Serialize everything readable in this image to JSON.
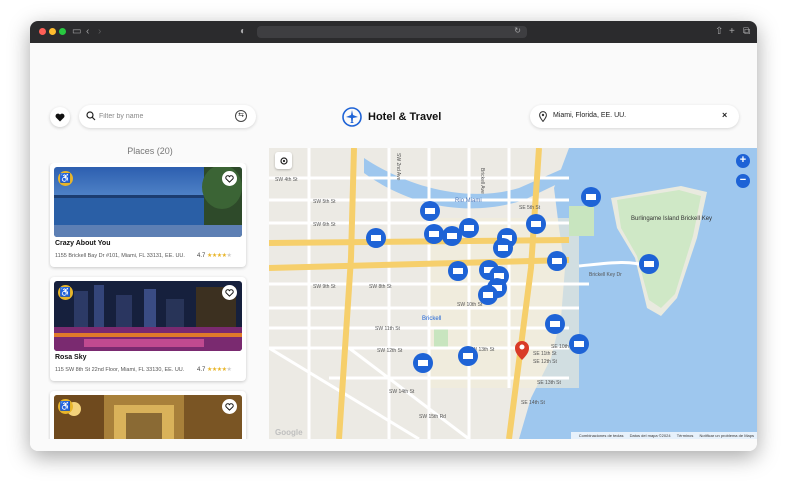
{
  "brand": {
    "title": "Hotel & Travel"
  },
  "filter": {
    "placeholder": "Filter by name"
  },
  "location": {
    "value": "Miami, Florida, EE. UU.",
    "clear": "×"
  },
  "places": {
    "title": "Places (20)"
  },
  "cards": [
    {
      "name": "Crazy About You",
      "address": "1155 Brickell Bay Dr #101, Miami, FL 33131, EE. UU.",
      "rating": "4.7",
      "stars": 4.5
    },
    {
      "name": "Rosa Sky",
      "address": "115 SW 8th St 22nd Floor, Miami, FL 33130, EE. UU.",
      "rating": "4.7",
      "stars": 4.5
    },
    {
      "name": "",
      "address": "",
      "rating": "",
      "stars": 0
    }
  ],
  "map": {
    "zoom_in": "+",
    "zoom_out": "−",
    "logo": "Google",
    "attribution": [
      "Combinaciones de teclas",
      "Datos del mapa ©2024",
      "Términos",
      "Notificar un problema de Maps"
    ],
    "labels": [
      "SW 4th St",
      "SW 5th St",
      "SW 6th St",
      "SW 8th St",
      "SW 9th St",
      "SW 10th St",
      "SW 11th St",
      "SW 12th St",
      "SW 13th St",
      "SW 14th St",
      "SW 15th Rd",
      "Rio Miami",
      "SE 5th St",
      "SE 10th St",
      "SE 11th St",
      "SE 12th St",
      "SE 13th St",
      "SE 14th St",
      "Brickell",
      "Brickell Key Dr",
      "Burlingame Island Brickell Key",
      "SW 2nd Ave",
      "Brickell Ave"
    ],
    "markers_count": 19
  },
  "colors": {
    "accent": "#1e63d6",
    "star": "#e8b52a",
    "water": "#9ec7ee",
    "pin_red": "#d93b27"
  }
}
